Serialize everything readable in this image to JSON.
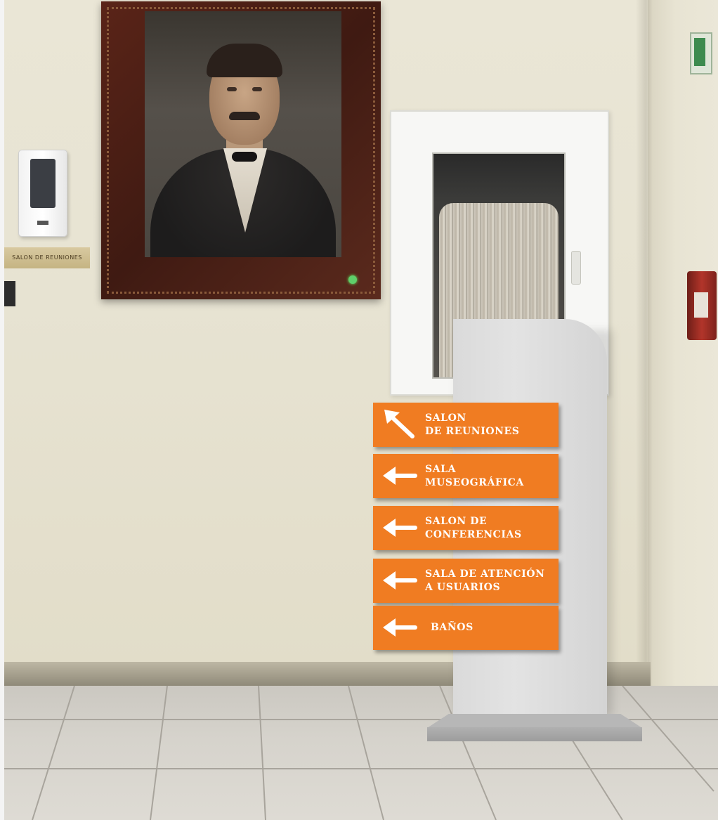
{
  "wall_plaque": {
    "text": "SALON DE REUNIONES"
  },
  "signs": [
    {
      "text": "SALON\nDE REUNIONES",
      "arrow_icon": "arrow-up-left-icon"
    },
    {
      "text": "SALA\nMUSEOGRÁFICA",
      "arrow_icon": "arrow-left-icon"
    },
    {
      "text": "SALON DE\nCONFERENCIAS",
      "arrow_icon": "arrow-left-icon"
    },
    {
      "text": "SALA DE ATENCIÓN\nA USUARIOS",
      "arrow_icon": "arrow-left-icon"
    },
    {
      "text": "BAÑOS",
      "arrow_icon": "arrow-left-icon"
    }
  ],
  "colors": {
    "sign_orange": "#f07c22",
    "sign_text": "#ffffff",
    "totem": "#dedede",
    "wall": "#e8e4d3"
  }
}
